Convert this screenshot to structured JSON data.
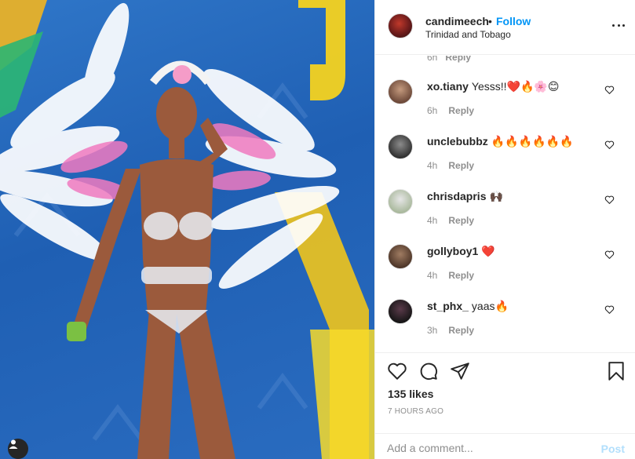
{
  "post": {
    "username": "candimeech",
    "separator": "•",
    "follow_label": "Follow",
    "location": "Trinidad and Tobago",
    "likes": "135 likes",
    "timestamp": "7 HOURS AGO"
  },
  "partial_comment": {
    "time": "6h",
    "reply_label": "Reply"
  },
  "comments": [
    {
      "username": "xo.tiany",
      "text": "Yesss!!❤️🔥🌸😊",
      "time": "6h",
      "reply_label": "Reply"
    },
    {
      "username": "unclebubbz",
      "text": "🔥🔥🔥🔥🔥🔥",
      "time": "4h",
      "reply_label": "Reply"
    },
    {
      "username": "chrisdapris",
      "text": "🙌🏿",
      "time": "4h",
      "reply_label": "Reply"
    },
    {
      "username": "gollyboy1",
      "text": "❤️",
      "time": "4h",
      "reply_label": "Reply"
    },
    {
      "username": "st_phx_",
      "text": "yaas🔥",
      "time": "3h",
      "reply_label": "Reply"
    }
  ],
  "add_comment": {
    "placeholder": "Add a comment...",
    "post_label": "Post"
  },
  "icons": {
    "like": "heart-icon",
    "comment": "comment-icon",
    "share": "paper-plane-icon",
    "save": "bookmark-icon",
    "more": "more-options-icon",
    "user_tag": "user-icon"
  },
  "colors": {
    "accent": "#0095f6",
    "post_disabled": "#b2dffc",
    "muted": "#8e8e8e",
    "photo_bg": "#2a6cc0"
  }
}
